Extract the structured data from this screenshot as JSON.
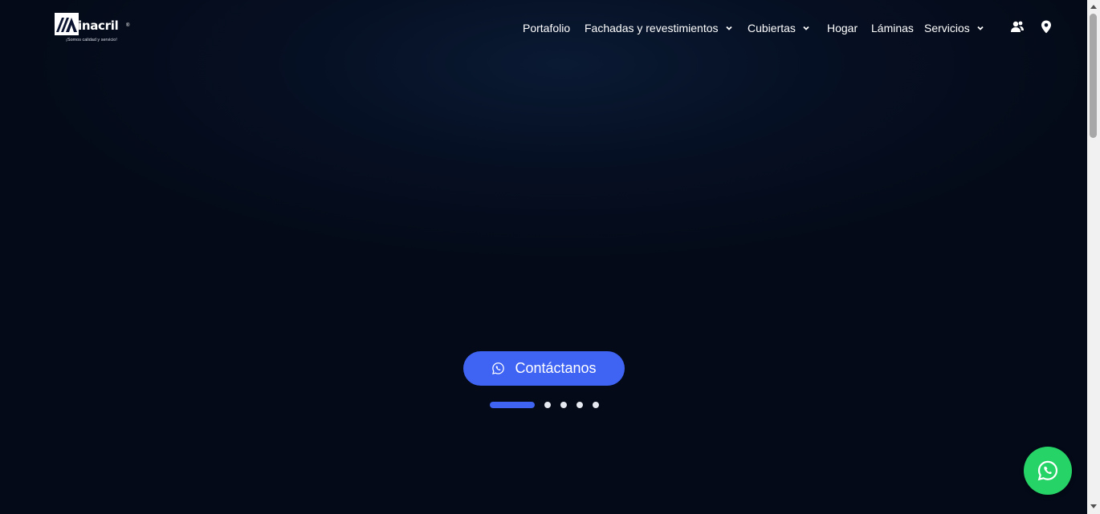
{
  "logo": {
    "name": "inacril",
    "registered": "®",
    "tagline": "¡Somos calidad y servicio!"
  },
  "nav": {
    "items": [
      {
        "label": "Portafolio",
        "has_dropdown": false
      },
      {
        "label": "Fachadas y revestimientos",
        "has_dropdown": true
      },
      {
        "label": "Cubiertas",
        "has_dropdown": true
      },
      {
        "label": "Hogar",
        "has_dropdown": false
      },
      {
        "label": "Láminas",
        "has_dropdown": false
      },
      {
        "label": "Servicios",
        "has_dropdown": true
      }
    ],
    "icons": [
      "users-icon",
      "location-pin-icon"
    ]
  },
  "hero": {
    "cta_label": "Contáctanos",
    "cta_icon": "whatsapp-icon",
    "slides_total": 5,
    "active_slide": 1
  },
  "floating_button": {
    "icon": "whatsapp-icon"
  },
  "colors": {
    "accent": "#3f63f2",
    "whatsapp": "#25d366",
    "background": "#050c1c"
  }
}
